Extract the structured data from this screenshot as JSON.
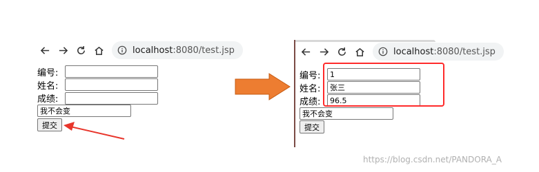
{
  "browser": {
    "url_host": "localhost",
    "url_rest": ":8080/test.jsp",
    "icons": [
      "back-icon",
      "forward-icon",
      "reload-icon",
      "home-icon",
      "info-icon"
    ]
  },
  "before": {
    "fields": [
      {
        "label": "编号:",
        "value": ""
      },
      {
        "label": "姓名:",
        "value": ""
      },
      {
        "label": "成绩:",
        "value": ""
      }
    ],
    "result_value": "我不会变",
    "submit_label": "提交"
  },
  "after": {
    "fields": [
      {
        "label": "编号:",
        "value": "1"
      },
      {
        "label": "姓名:",
        "value": "张三"
      },
      {
        "label": "成绩:",
        "value": "96.5"
      }
    ],
    "result_value": "我不会变",
    "submit_label": "提交"
  },
  "watermark": "https://blog.csdn.net/PANDORA_A",
  "colors": {
    "arrow_orange": "#ED7D31",
    "highlight_red": "#FF2A2A",
    "pointer_red": "#E8352B"
  }
}
